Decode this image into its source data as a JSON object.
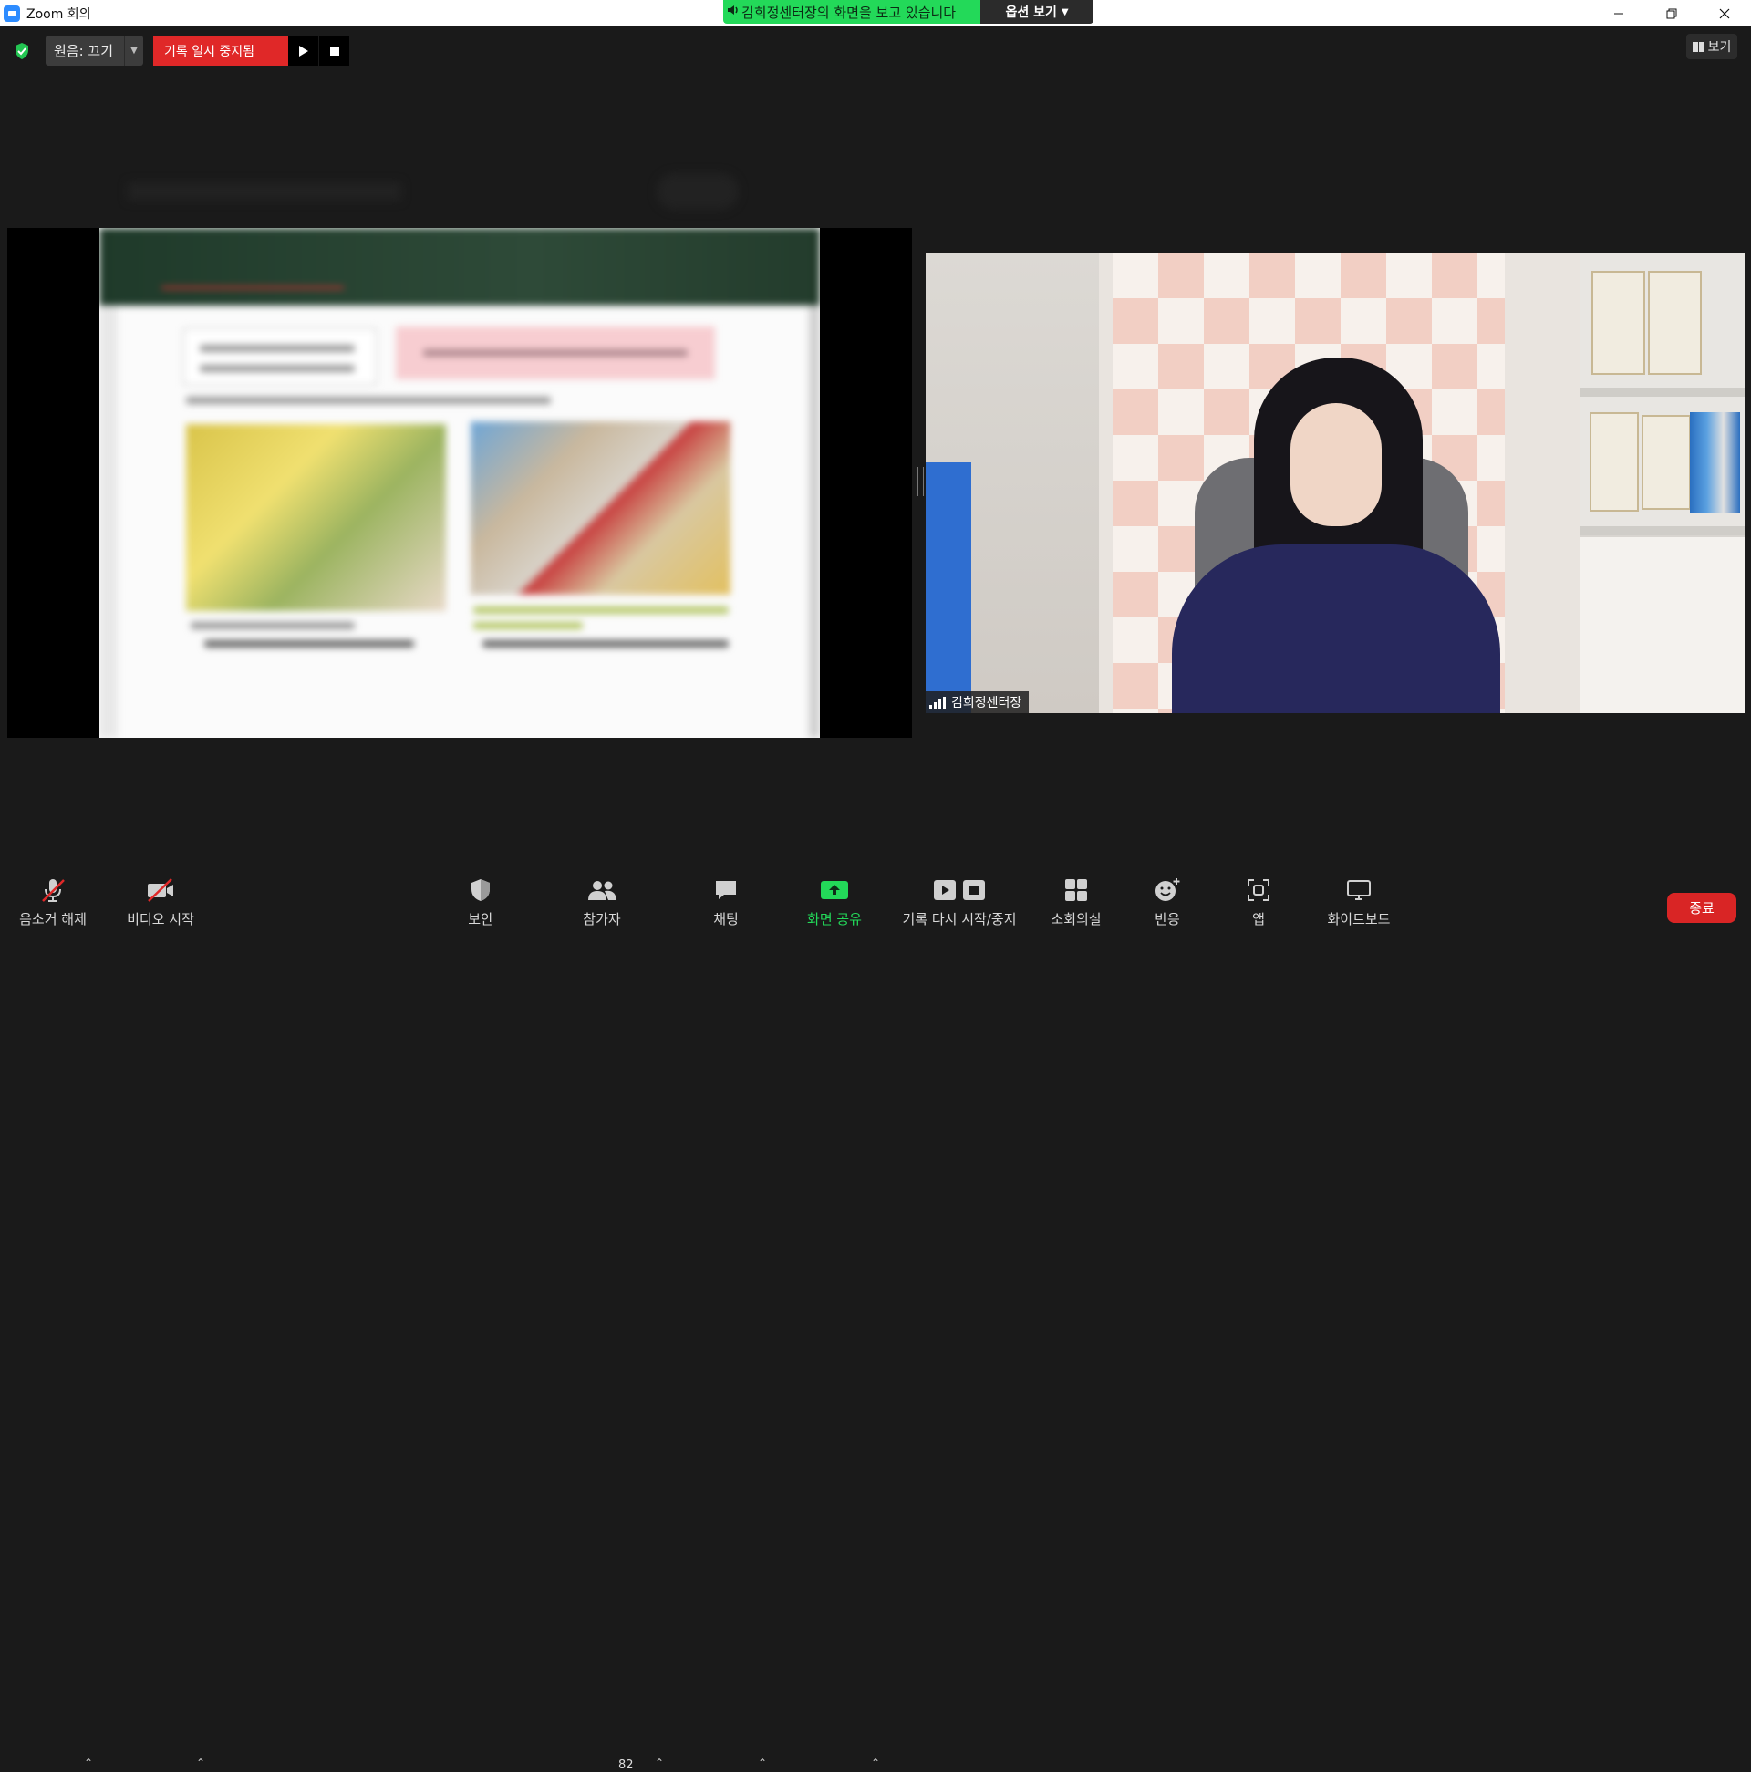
{
  "window": {
    "title": "Zoom 회의"
  },
  "share_banner": {
    "text": "김희정센터장의 화면을 보고 있습니다",
    "options_label": "옵션 보기"
  },
  "top_controls": {
    "original_sound_label": "원음: 끄기",
    "recording_status": "기록 일시 중지됨"
  },
  "view_button": {
    "label": "보기"
  },
  "video": {
    "participant_name": "김희정센터장"
  },
  "toolbar": {
    "unmute_label": "음소거 해제",
    "start_video_label": "비디오 시작",
    "security_label": "보안",
    "participants_label": "참가자",
    "participants_count": "82",
    "chat_label": "채팅",
    "share_screen_label": "화면 공유",
    "record_label": "기록 다시 시작/중지",
    "breakout_label": "소회의실",
    "reactions_label": "반응",
    "apps_label": "앱",
    "whiteboard_label": "화이트보드",
    "end_label": "종료"
  },
  "colors": {
    "share_green": "#23d959",
    "recording_red": "#e02828",
    "end_red": "#d92525",
    "background": "#1a1a1a"
  }
}
